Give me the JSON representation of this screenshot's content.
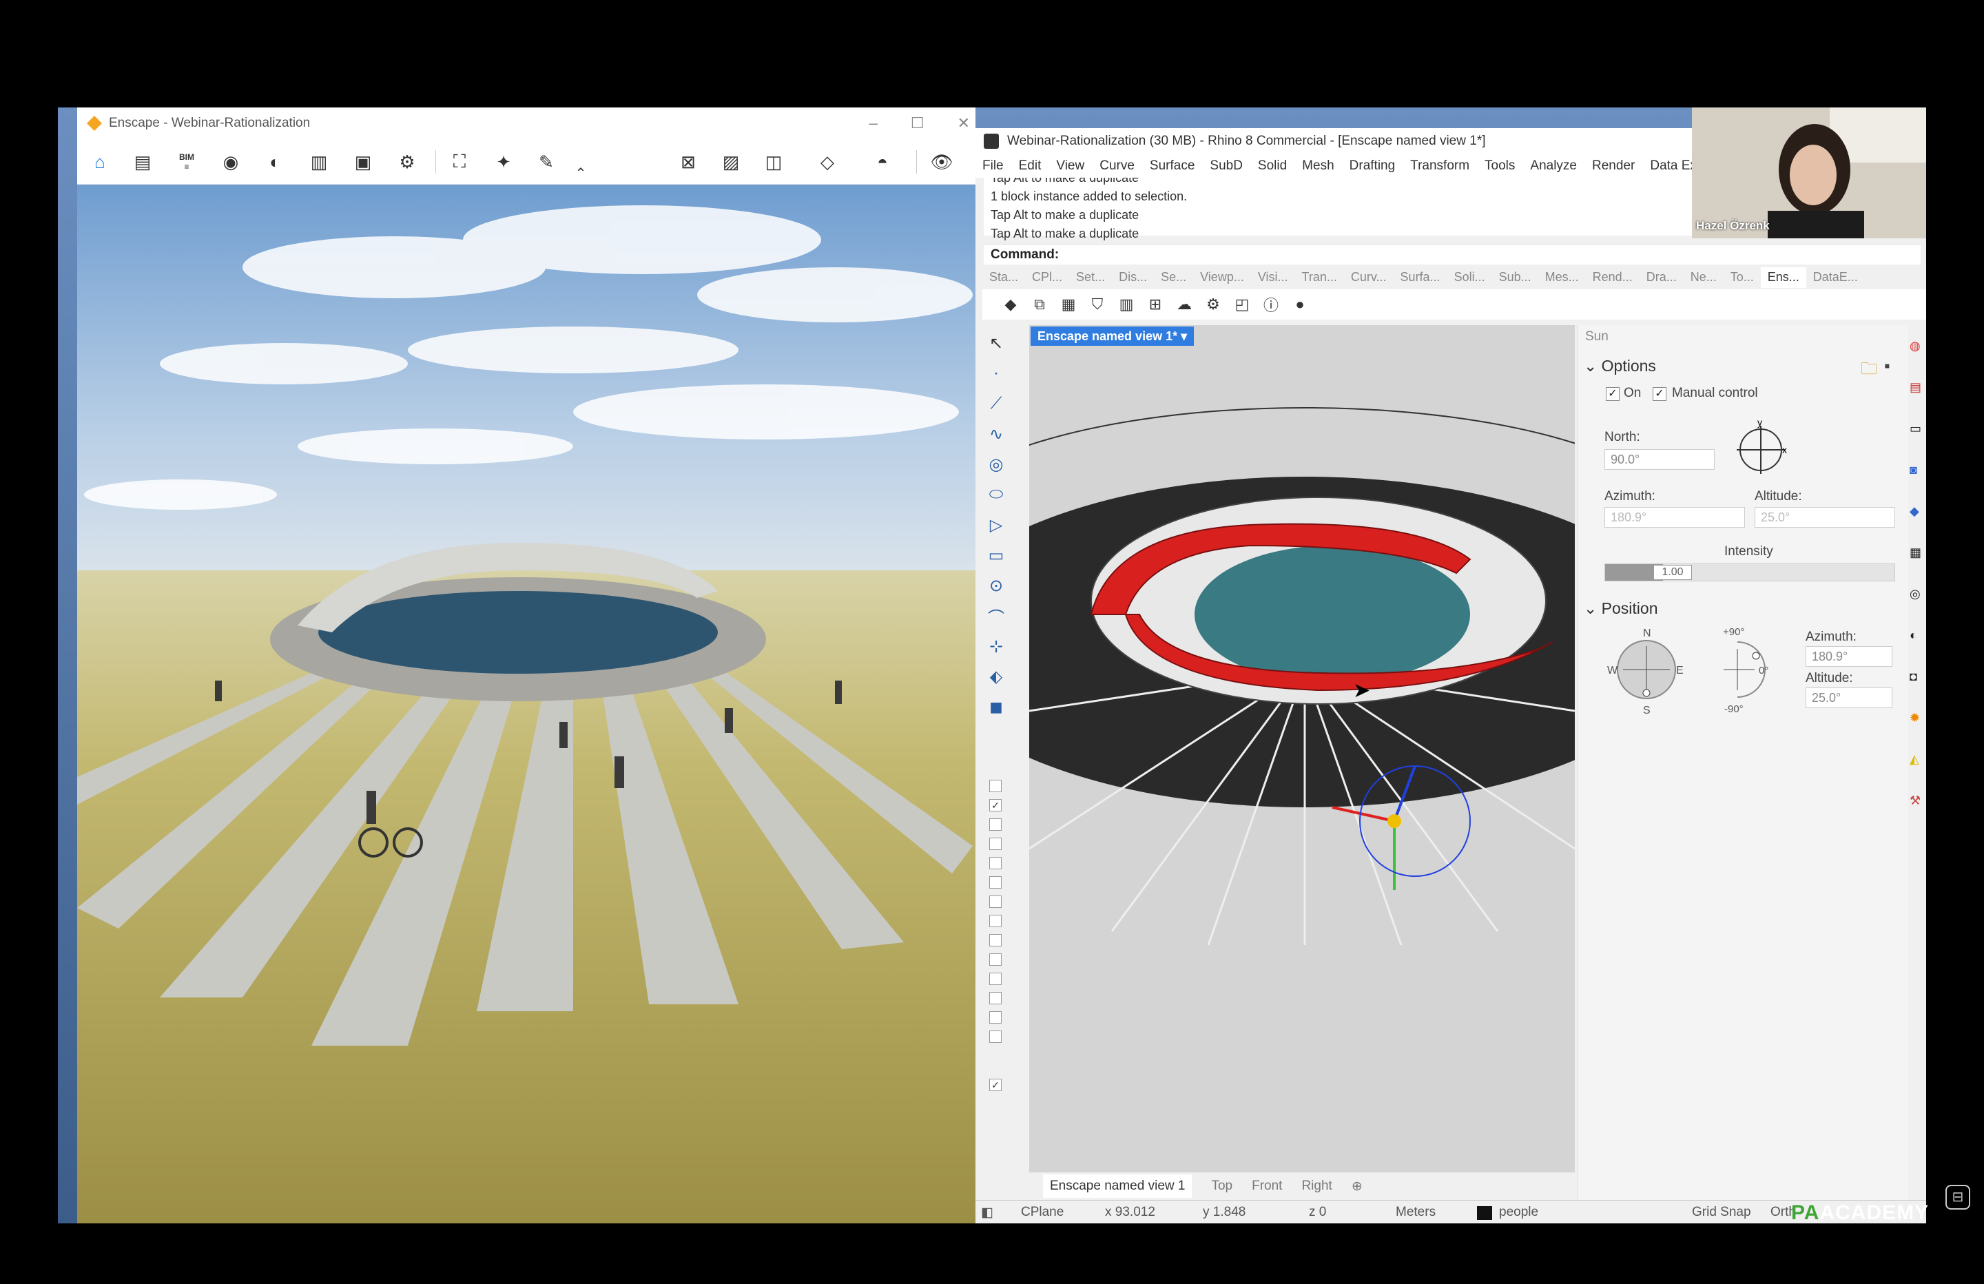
{
  "enscape": {
    "title": "Enscape - Webinar-Rationalization",
    "toolbar_icons": [
      "home-icon",
      "notes-icon",
      "bim-icon",
      "views-icon",
      "atmosphere-icon",
      "building-icon",
      "asset-library-icon",
      "settings-icon",
      "screenshot-icon",
      "magic-wand-icon",
      "pen-icon",
      "chevron-up-icon",
      "map-icon",
      "image-icon",
      "cube-icon",
      "materials-icon",
      "vr-headset-icon",
      "eye-icon"
    ],
    "bim_label": "BIM"
  },
  "rhino": {
    "title": "Webinar-Rationalization (30 MB) - Rhino 8 Commercial - [Enscape named view 1*]",
    "menu": [
      "File",
      "Edit",
      "View",
      "Curve",
      "Surface",
      "SubD",
      "Solid",
      "Mesh",
      "Drafting",
      "Transform",
      "Tools",
      "Analyze",
      "Render",
      "Data Ex"
    ],
    "history": [
      "Tap Alt to make a duplicate",
      "1 block instance added to selection.",
      "Tap Alt to make a duplicate",
      "Tap Alt to make a duplicate"
    ],
    "command_label": "Command:",
    "toolbar_tabs": [
      "Sta...",
      "CPl...",
      "Set...",
      "Dis...",
      "Se...",
      "Viewp...",
      "Visi...",
      "Tran...",
      "Curv...",
      "Surfa...",
      "Soli...",
      "Sub...",
      "Mes...",
      "Rend...",
      "Dra...",
      "Ne...",
      "To...",
      "Ens...",
      "DataE..."
    ],
    "active_tab": "Ens...",
    "viewport_label": "Enscape named view 1*",
    "viewport_tabs": [
      "Enscape named view 1",
      "Top",
      "Front",
      "Right"
    ],
    "status": {
      "cplane": "CPlane",
      "x": "x 93.012",
      "y": "y 1.848",
      "z": "z 0",
      "units": "Meters",
      "layer": "people",
      "grid_snap": "Grid Snap",
      "ortho": "Orth"
    },
    "sun_panel": {
      "title": "Sun",
      "options_heading": "Options",
      "on_label": "On",
      "manual_label": "Manual control",
      "north_label": "North:",
      "north_value": "90.0°",
      "azimuth_label": "Azimuth:",
      "azimuth_value": "180.9°",
      "altitude_label": "Altitude:",
      "altitude_value": "25.0°",
      "intensity_label": "Intensity",
      "intensity_value": "1.00",
      "intensity_fraction": 0.2,
      "position_heading": "Position",
      "compass": {
        "n": "N",
        "s": "S",
        "e": "E",
        "w": "W"
      },
      "alt_dial": {
        "top": "+90°",
        "mid": "0°",
        "bottom": "-90°"
      },
      "pos_azimuth_label": "Azimuth:",
      "pos_azimuth_value": "180.9°",
      "pos_altitude_label": "Altitude:",
      "pos_altitude_value": "25.0°",
      "axis_x": "x",
      "axis_y": "y"
    },
    "layer_checks": [
      false,
      true,
      false,
      false,
      false,
      false,
      false,
      false,
      false,
      false,
      false,
      false,
      false,
      false
    ],
    "bottom_check": true
  },
  "webcam": {
    "name": "Hazel Özrenk"
  },
  "watermark": {
    "pa": "PA",
    "rest": "ACADEMY"
  },
  "colors": {
    "accent": "#2f7de1",
    "enscape_orange": "#f4a623",
    "red_ring": "#d8211f",
    "grass": "#b7ad62",
    "sky": "#7fa9d6"
  }
}
